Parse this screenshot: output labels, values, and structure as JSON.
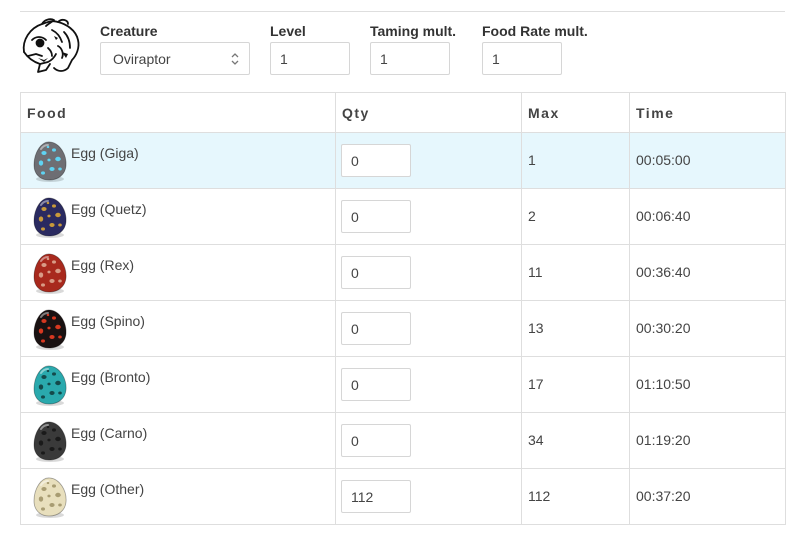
{
  "controls": {
    "creature_label": "Creature",
    "creature_value": "Oviraptor",
    "level_label": "Level",
    "level_value": "1",
    "taming_label": "Taming mult.",
    "taming_value": "1",
    "food_rate_label": "Food Rate mult.",
    "food_rate_value": "1"
  },
  "table": {
    "headers": {
      "food": "Food",
      "qty": "Qty",
      "max": "Max",
      "time": "Time"
    },
    "rows": [
      {
        "food": "Egg (Giga)",
        "qty": "0",
        "max": "1",
        "time": "00:05:00",
        "egg_color": "#6e6e73",
        "spot_color": "#5fd3f2"
      },
      {
        "food": "Egg (Quetz)",
        "qty": "0",
        "max": "2",
        "time": "00:06:40",
        "egg_color": "#2a2a60",
        "spot_color": "#c89a3a"
      },
      {
        "food": "Egg (Rex)",
        "qty": "0",
        "max": "11",
        "time": "00:36:40",
        "egg_color": "#a8291d",
        "spot_color": "#d89b86"
      },
      {
        "food": "Egg (Spino)",
        "qty": "0",
        "max": "13",
        "time": "00:30:20",
        "egg_color": "#1a1212",
        "spot_color": "#d73820"
      },
      {
        "food": "Egg (Bronto)",
        "qty": "0",
        "max": "17",
        "time": "01:10:50",
        "egg_color": "#2aa9ad",
        "spot_color": "#14494b"
      },
      {
        "food": "Egg (Carno)",
        "qty": "0",
        "max": "34",
        "time": "01:19:20",
        "egg_color": "#3a3a3a",
        "spot_color": "#1a1a1a"
      },
      {
        "food": "Egg (Other)",
        "qty": "112",
        "max": "112",
        "time": "00:37:20",
        "egg_color": "#e8dfbd",
        "spot_color": "#a89c72"
      }
    ],
    "highlight_row": 0
  },
  "colors": {
    "highlight_row_bg": "#e6f7fd",
    "border": "#dedede"
  },
  "icons": {
    "creature": "oviraptor-sketch-icon",
    "select": "select-arrows-icon"
  }
}
